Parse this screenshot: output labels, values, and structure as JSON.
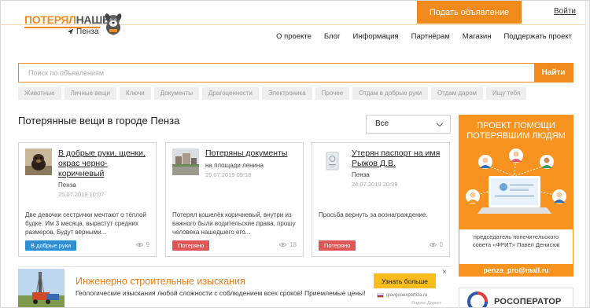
{
  "header": {
    "logo": {
      "part1": "ПОТЕРЯЛ",
      "part2": "НАШЕЛ",
      "city": "Пенза"
    },
    "post_button": "Подать объявление",
    "login": "Войти",
    "nav": [
      "О проекте",
      "Блог",
      "Информация",
      "Партнёрам",
      "Магазин",
      "Поддержать проект"
    ]
  },
  "search": {
    "placeholder": "Поиск по объявлениям",
    "button": "Найти"
  },
  "tags": [
    "Животные",
    "Личные вещи",
    "Ключи",
    "Документы",
    "Драгоценности",
    "Электроника",
    "Прочее",
    "Отдам в добрые руки",
    "Отдам даром",
    "Ищу тебя"
  ],
  "main": {
    "title": "Потерянные вещи в городе Пенза",
    "filter": {
      "selected": "Все"
    },
    "cards": [
      {
        "title": "В добрые руки, щенки, окрас черно-коричневый",
        "city": "Пенза",
        "date": "25.07.2019 10:07",
        "desc": "Две девочки сестрички мечтают о тёплой будке. Им 3 месяца, вырастут средних размеров. Будут верными...",
        "badge": "В добрые руки",
        "views": "9",
        "badge_color": "#2f8fd0"
      },
      {
        "title": "Потеряны документы",
        "city": "на площади ленина",
        "date": "25.07.2019 09:18",
        "desc": "Потерял кошелёк коричневый, внутри из важного были водительские права, прошу человека нашедшего его...",
        "badge": "Потеряно",
        "views": "18",
        "badge_color": "#e05656"
      },
      {
        "title": "Утерян паспорт на имя Рыжов Д.В.",
        "city": "Пенза",
        "date": "24.07.2019 20:39",
        "desc": "Просьба вернуть за вознаграждение.",
        "badge": "Потеряно",
        "views": "0",
        "badge_color": "#e05656"
      }
    ]
  },
  "sidebar": {
    "promo": {
      "title_line1": "ПРОЕКТ ПОМОЩИ",
      "title_line2": "ПОТЕРЯВШИМ ЛЮДЯМ",
      "caption_line1": "председатель попечительского",
      "caption_line2": "совета «ФРИТ» Павел Денисюк",
      "email": "penza_pro@mail.ru",
      "color": "#f7931e"
    },
    "ros": {
      "label": "РОСОПЕРАТОР"
    }
  },
  "ad": {
    "title": "Инженерно строительные изыскания",
    "text": "Геологические изыскания любой сложности с соблюдением всех сроков! Приемлемые цены!",
    "button": "Узнать больше",
    "close": "×",
    "domain": "glavgeoexpertiza.ru",
    "source": "Яндекс.Директ"
  },
  "colors": {
    "accent": "#f08a1c",
    "badge_blue": "#2f8fd0",
    "badge_red": "#e05656"
  }
}
